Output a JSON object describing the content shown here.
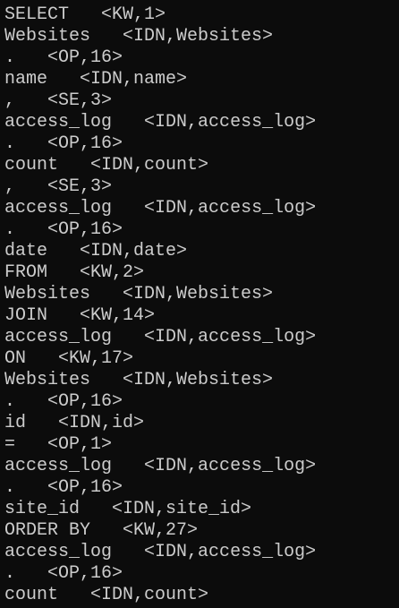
{
  "lines": [
    {
      "token": "SELECT",
      "info": "<KW,1>"
    },
    {
      "token": "Websites",
      "info": "<IDN,Websites>"
    },
    {
      "token": ".",
      "info": "<OP,16>"
    },
    {
      "token": "name",
      "info": "<IDN,name>"
    },
    {
      "token": ",",
      "info": "<SE,3>"
    },
    {
      "token": "access_log",
      "info": "<IDN,access_log>"
    },
    {
      "token": ".",
      "info": "<OP,16>"
    },
    {
      "token": "count",
      "info": "<IDN,count>"
    },
    {
      "token": ",",
      "info": "<SE,3>"
    },
    {
      "token": "access_log",
      "info": "<IDN,access_log>"
    },
    {
      "token": ".",
      "info": "<OP,16>"
    },
    {
      "token": "date",
      "info": "<IDN,date>"
    },
    {
      "token": "FROM",
      "info": "<KW,2>"
    },
    {
      "token": "Websites",
      "info": "<IDN,Websites>"
    },
    {
      "token": "JOIN",
      "info": "<KW,14>"
    },
    {
      "token": "access_log",
      "info": "<IDN,access_log>"
    },
    {
      "token": "ON",
      "info": "<KW,17>"
    },
    {
      "token": "Websites",
      "info": "<IDN,Websites>"
    },
    {
      "token": ".",
      "info": "<OP,16>"
    },
    {
      "token": "id",
      "info": "<IDN,id>"
    },
    {
      "token": "=",
      "info": "<OP,1>"
    },
    {
      "token": "access_log",
      "info": "<IDN,access_log>"
    },
    {
      "token": ".",
      "info": "<OP,16>"
    },
    {
      "token": "site_id",
      "info": "<IDN,site_id>"
    },
    {
      "token": "ORDER BY",
      "info": "<KW,27>"
    },
    {
      "token": "access_log",
      "info": "<IDN,access_log>"
    },
    {
      "token": ".",
      "info": "<OP,16>"
    },
    {
      "token": "count",
      "info": "<IDN,count>"
    }
  ]
}
